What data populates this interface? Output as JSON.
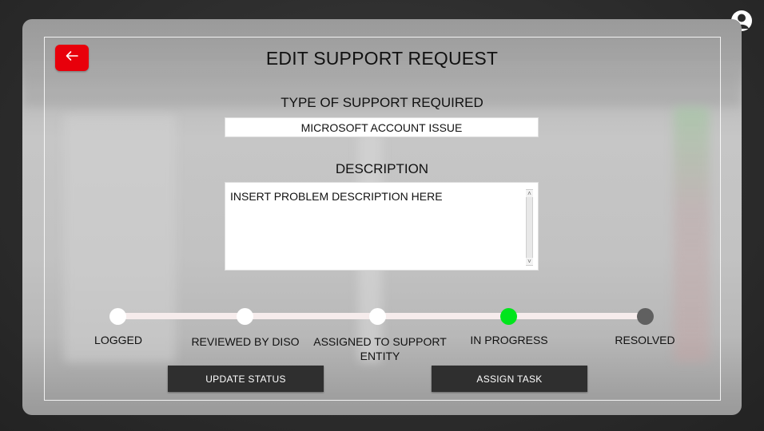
{
  "header": {
    "title": "EDIT SUPPORT REQUEST",
    "back_icon": "arrow-left-icon",
    "user_icon": "user-icon"
  },
  "form": {
    "type_label": "TYPE OF SUPPORT REQUIRED",
    "type_value": "MICROSOFT ACCOUNT ISSUE",
    "description_label": "DESCRIPTION",
    "description_value": "INSERT PROBLEM DESCRIPTION HERE"
  },
  "status": {
    "steps": [
      {
        "label": "LOGGED",
        "state": "done"
      },
      {
        "label": "REVIEWED BY DISO",
        "state": "done"
      },
      {
        "label": "ASSIGNED TO SUPPORT ENTITY",
        "state": "done"
      },
      {
        "label": "IN PROGRESS",
        "state": "current"
      },
      {
        "label": "RESOLVED",
        "state": "pending"
      }
    ],
    "colors": {
      "done": "#ffffff",
      "current": "#00e51c",
      "pending": "#606060",
      "track": "#f6ecec"
    }
  },
  "actions": {
    "update_status": "UPDATE STATUS",
    "assign_task": "ASSIGN TASK"
  },
  "colors": {
    "back_button": "#e8000b",
    "action_button": "#2f2f2f"
  }
}
